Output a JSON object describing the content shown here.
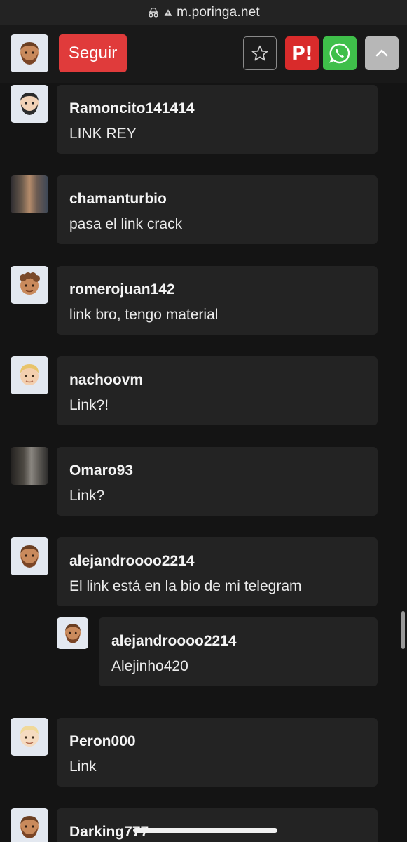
{
  "browser": {
    "url": "m.poringa.net"
  },
  "header": {
    "follow_label": "Seguir",
    "p_label": "P!",
    "icons": [
      "star-icon",
      "poringa-logo",
      "whatsapp-icon",
      "chevron-up-icon"
    ],
    "colors": {
      "follow": "#e03b3b",
      "poringa": "#d92b2b",
      "whatsapp": "#3fbf4a",
      "up": "#b7b7b7"
    }
  },
  "comments": [
    {
      "user": "Ramoncito141414",
      "text": "LINK REY",
      "avatar": "bearded-man-emoji"
    },
    {
      "user": "chamanturbio",
      "text": "pasa el link crack",
      "avatar": "photo"
    },
    {
      "user": "romerojuan142",
      "text": "link bro, tengo material",
      "avatar": "man-curly-hair-emoji"
    },
    {
      "user": "nachoovm",
      "text": "Link?!",
      "avatar": "man-blond-emoji"
    },
    {
      "user": "Omaro93",
      "text": "Link?",
      "avatar": "photo"
    },
    {
      "user": "alejandroooo2214",
      "text": "El link está en la bio de mi telegram",
      "avatar": "bearded-man-emoji"
    },
    {
      "user": "alejandroooo2214",
      "text": "Alejinho420",
      "avatar": "bearded-man-emoji",
      "reply": true
    },
    {
      "user": "Peron000",
      "text": "Link",
      "avatar": "man-blond-emoji"
    },
    {
      "user": "Darking777",
      "text": "",
      "avatar": "bearded-man-emoji"
    }
  ]
}
